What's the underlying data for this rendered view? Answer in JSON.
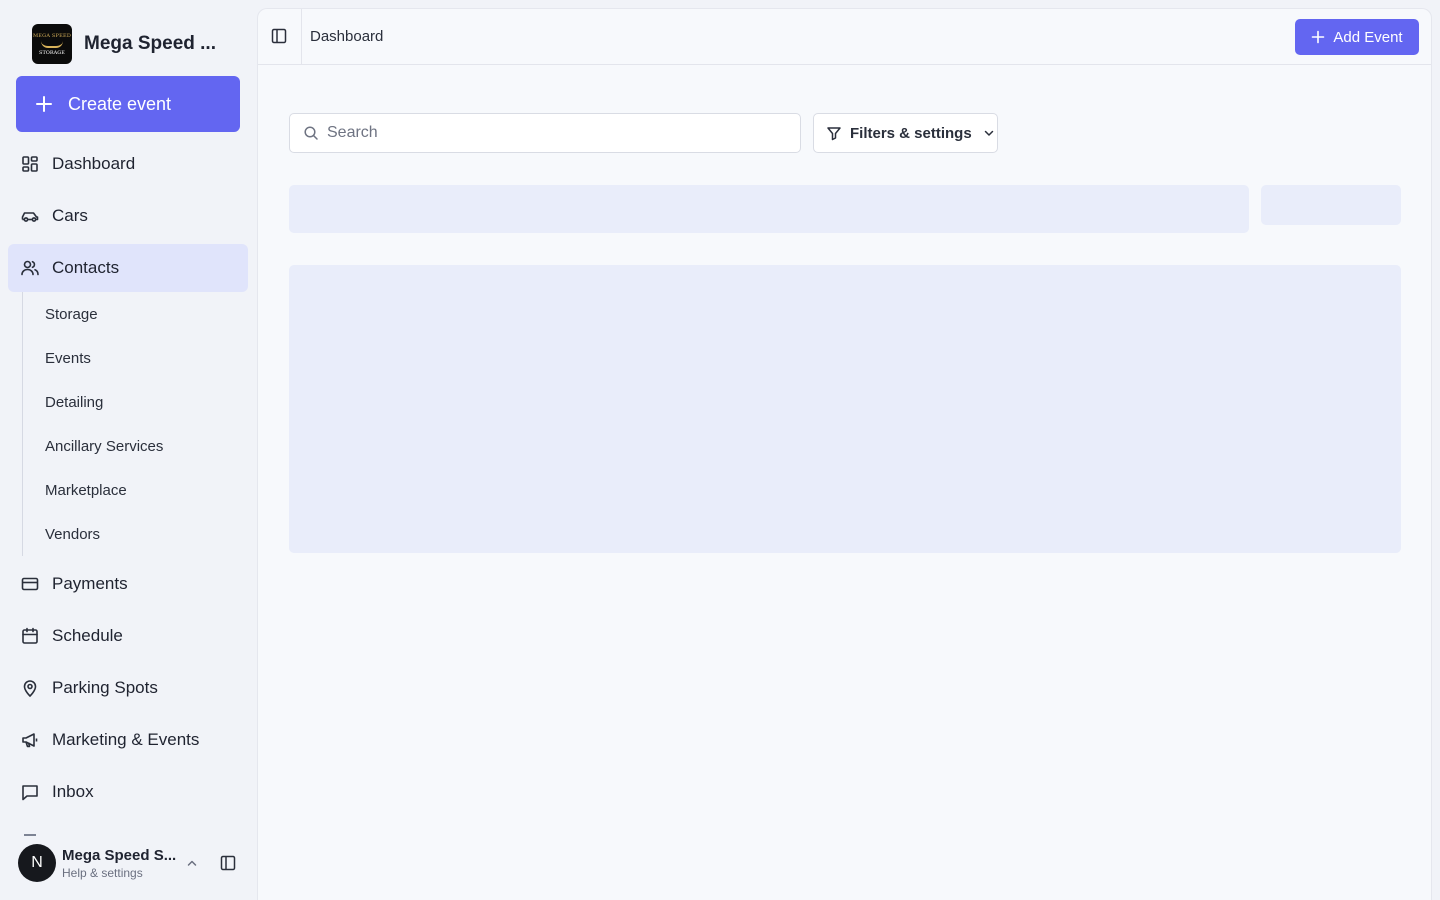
{
  "brand": {
    "name": "Mega Speed ...",
    "logo_text_top": "MEGA SPEED",
    "logo_text_bottom": "STORAGE"
  },
  "sidebar": {
    "create_label": "Create event",
    "items": [
      {
        "label": "Dashboard",
        "icon": "dashboard-icon"
      },
      {
        "label": "Cars",
        "icon": "car-icon"
      },
      {
        "label": "Contacts",
        "icon": "users-icon",
        "active": true
      },
      {
        "label": "Payments",
        "icon": "credit-card-icon"
      },
      {
        "label": "Schedule",
        "icon": "calendar-icon"
      },
      {
        "label": "Parking Spots",
        "icon": "map-pin-icon"
      },
      {
        "label": "Marketing & Events",
        "icon": "megaphone-icon"
      },
      {
        "label": "Inbox",
        "icon": "message-square-icon"
      }
    ],
    "subitems": [
      {
        "label": "Storage"
      },
      {
        "label": "Events"
      },
      {
        "label": "Detailing"
      },
      {
        "label": "Ancillary Services"
      },
      {
        "label": "Marketplace"
      },
      {
        "label": "Vendors"
      }
    ]
  },
  "user": {
    "initial": "N",
    "name": "Mega Speed S...",
    "subtitle": "Help & settings"
  },
  "topbar": {
    "breadcrumb": "Dashboard",
    "add_label": "Add Event"
  },
  "toolbar": {
    "search_placeholder": "Search",
    "filters_label": "Filters & settings"
  },
  "colors": {
    "accent": "#6366f1",
    "active_nav": "#e0e4fb",
    "skeleton": "#e9edfa",
    "background": "#f1f3f8"
  }
}
